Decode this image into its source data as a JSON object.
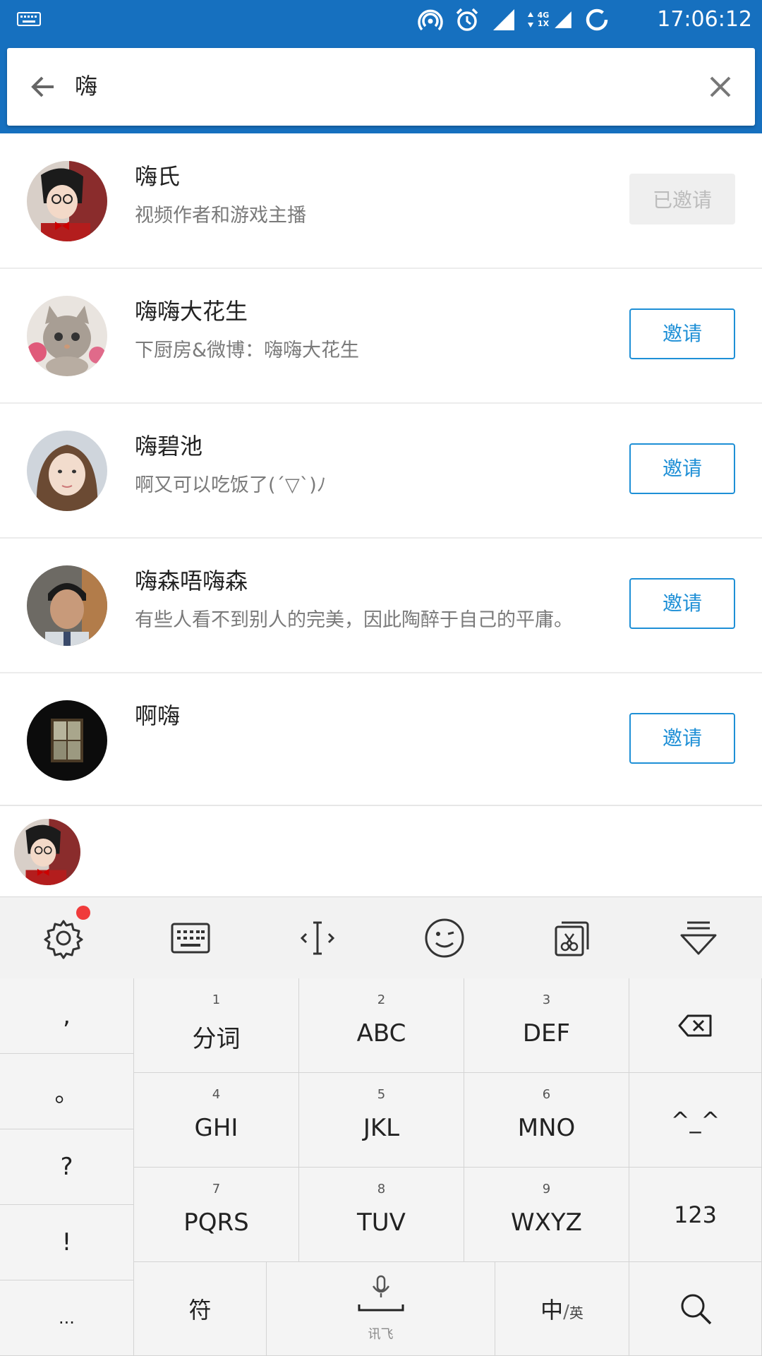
{
  "status_bar": {
    "time": "17:06:12",
    "network_label_top": "4G",
    "network_label_bottom": "1X"
  },
  "search": {
    "query": "嗨"
  },
  "results": [
    {
      "name": "嗨氏",
      "desc": "视频作者和游戏主播",
      "action": "已邀请",
      "invited": true
    },
    {
      "name": "嗨嗨大花生",
      "desc": "下厨房&微博：嗨嗨大花生",
      "action": "邀请",
      "invited": false
    },
    {
      "name": "嗨碧池",
      "desc": "啊又可以吃饭了(´▽`)ﾉ",
      "action": "邀请",
      "invited": false
    },
    {
      "name": "嗨森唔嗨森",
      "desc": "有些人看不到别人的完美，因此陶醉于自己的平庸。",
      "action": "邀请",
      "invited": false
    },
    {
      "name": "啊嗨",
      "desc": "",
      "action": "邀请",
      "invited": false
    }
  ],
  "keyboard": {
    "punctuation": [
      ",",
      "。",
      "?",
      "!",
      "..."
    ],
    "t9_keys": [
      {
        "num": "1",
        "label": "分词"
      },
      {
        "num": "2",
        "label": "ABC"
      },
      {
        "num": "3",
        "label": "DEF"
      },
      {
        "num": "4",
        "label": "GHI"
      },
      {
        "num": "5",
        "label": "JKL"
      },
      {
        "num": "6",
        "label": "MNO"
      },
      {
        "num": "7",
        "label": "PQRS"
      },
      {
        "num": "8",
        "label": "TUV"
      },
      {
        "num": "9",
        "label": "WXYZ"
      }
    ],
    "emoticon_key": "^_^",
    "numeric_key": "123",
    "symbol_key": "符",
    "space_brand": "讯飞",
    "lang_key_main": "中",
    "lang_key_sub": "英",
    "colors": {
      "accent": "#1e8fd6",
      "status_bar": "#1670bf",
      "notify_dot": "#f03b3b"
    }
  }
}
